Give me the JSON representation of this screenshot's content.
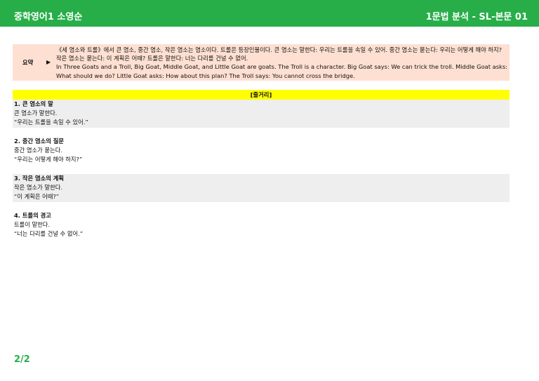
{
  "header": {
    "left_title": "중학영어1 소영순",
    "right_title": "1문법 분석 - SL-본문 01"
  },
  "summary": {
    "label": "요약",
    "arrow": "▶",
    "lines": [
      "《세 염소와 트롤》에서 큰 염소, 중간 염소, 작은 염소는 염소이다. 트롤은 등장인물이다. 큰 염소는 말한다: 우리는 트롤을 속일 수 있어. 중간 염소는 묻는다: 우리는 어떻게 해야 하지? 작은 염소는 묻는다: 이 계획은 어때? 트롤은 말한다: 너는 다리를 건널 수 없어.",
      "In Three Goats and a Troll, Big Goat, Middle Goat, and Little Goat are goats. The Troll is a character. Big Goat says: We can trick the troll. Middle Goat asks: What should we do? Little Goat asks: How about this plan? The Troll says: You cannot cross the bridge."
    ]
  },
  "storyline": {
    "label": "[줄거리]"
  },
  "sections": [
    {
      "title": "1. 큰 염소의 말",
      "lines": [
        "큰 염소가 말한다.",
        "“우리는 트롤을 속일 수 있어.”"
      ]
    },
    {
      "title": "2. 중간 염소의 질문",
      "lines": [
        "중간 염소가 묻는다.",
        "“우리는 어떻게 해야 하지?”"
      ]
    },
    {
      "title": "3. 작은 염소의 계획",
      "lines": [
        "작은 염소가 말한다.",
        "“이 계획은 어때?”"
      ]
    },
    {
      "title": "4. 트롤의 경고",
      "lines": [
        "트롤이 말한다.",
        "“너는 다리를 건널 수 없어.”"
      ]
    }
  ],
  "footer": {
    "page": "2/2"
  },
  "colors": {
    "header_green": "#27ae49",
    "summary_bg": "#fde0d2",
    "storyline_bg": "#ffff00",
    "shade_bg": "#eeeeee"
  }
}
